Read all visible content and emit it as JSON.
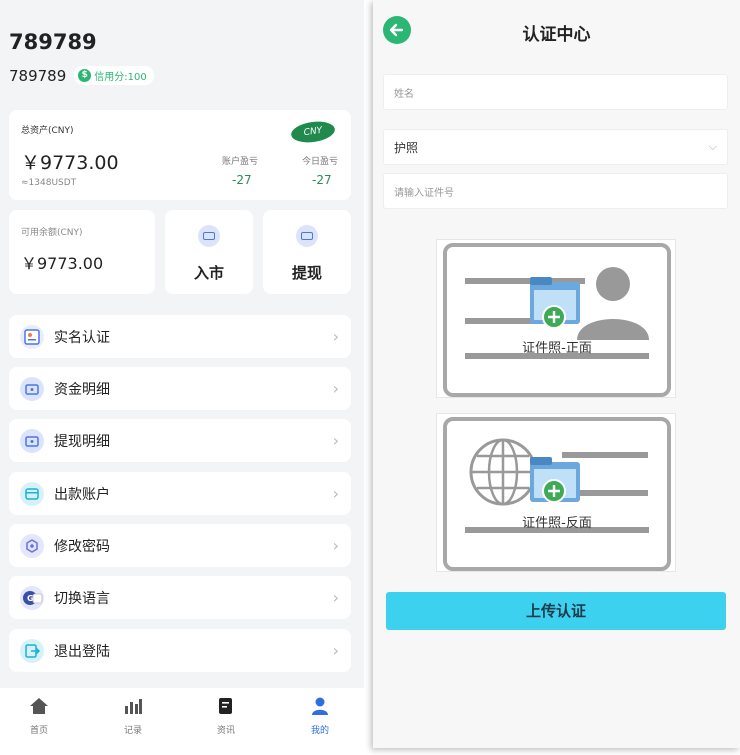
{
  "profile": {
    "username": "789789",
    "user_id": "789789",
    "credit_label": "信用分:100",
    "credit_icon": "credit-icon"
  },
  "asset": {
    "title": "总资产(CNY)",
    "currency_badge": "CNY",
    "amount": "￥9773.00",
    "usdt": "≈1348USDT",
    "account_pl_label": "账户盈亏",
    "account_pl_value": "-27",
    "today_pl_label": "今日盈亏",
    "today_pl_value": "-27"
  },
  "balance": {
    "title": "可用余额(CNY)",
    "amount": "￥9773.00"
  },
  "actions": [
    {
      "label": "入市",
      "icon": "wallet-icon"
    },
    {
      "label": "提现",
      "icon": "wallet-icon"
    }
  ],
  "menu": [
    {
      "label": "实名认证",
      "icon": "id-card-icon",
      "color": "#e8edf9"
    },
    {
      "label": "资金明细",
      "icon": "wallet-icon",
      "color": "#dbe4fb"
    },
    {
      "label": "提现明细",
      "icon": "wallet-icon",
      "color": "#dbe4fb"
    },
    {
      "label": "出款账户",
      "icon": "account-icon",
      "color": "#d6f1f7"
    },
    {
      "label": "修改密码",
      "icon": "lock-icon",
      "color": "#e4e6fa"
    },
    {
      "label": "切换语言",
      "icon": "translate-icon",
      "color": "#e4e6fa"
    },
    {
      "label": "退出登陆",
      "icon": "logout-icon",
      "color": "#d6f1f7"
    }
  ],
  "tabs": [
    {
      "label": "首页",
      "icon": "home-icon",
      "active": false
    },
    {
      "label": "记录",
      "icon": "chart-icon",
      "active": false
    },
    {
      "label": "资讯",
      "icon": "news-icon",
      "active": false
    },
    {
      "label": "我的",
      "icon": "user-icon",
      "active": true
    }
  ],
  "verify": {
    "title": "认证中心",
    "name_placeholder": "姓名",
    "doc_type": "护照",
    "id_placeholder": "请输入证件号",
    "front_caption": "证件照-正面",
    "back_caption": "证件照-反面",
    "upload_label": "上传认证"
  },
  "colors": {
    "accent_green": "#2bb673",
    "upload_button": "#3dd1f0",
    "active_tab": "#2f6fe0",
    "profit_text": "#2e8b57"
  }
}
